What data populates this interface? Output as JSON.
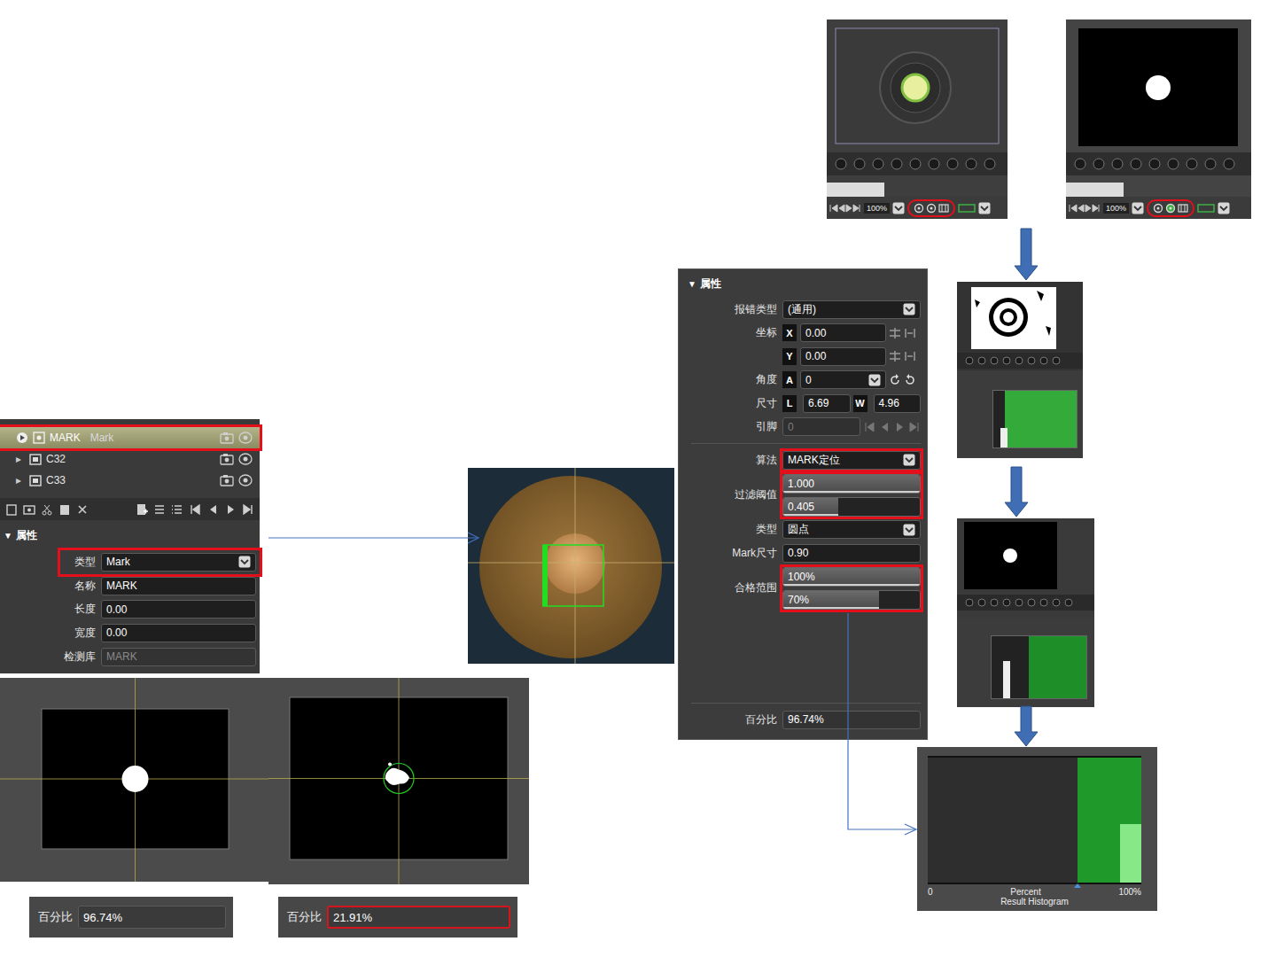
{
  "tree": {
    "rows": [
      {
        "kind": "mark",
        "name": "MARK",
        "type": "Mark",
        "selected": true,
        "annotated": true
      },
      {
        "kind": "group",
        "expander": "▸",
        "name": "C32",
        "selected": false,
        "annotated": false
      },
      {
        "kind": "group",
        "expander": "▸",
        "name": "C33",
        "selected": false,
        "annotated": false
      }
    ]
  },
  "left_props": {
    "arrow": "▼",
    "title": "属性",
    "fields": [
      {
        "kind": "select",
        "label": "类型",
        "value": "Mark",
        "disabled": false,
        "annotated": true
      },
      {
        "kind": "input",
        "label": "名称",
        "value": "MARK",
        "disabled": false,
        "annotated": false
      },
      {
        "kind": "input",
        "label": "长度",
        "value": "0.00",
        "disabled": false,
        "annotated": false
      },
      {
        "kind": "input",
        "label": "宽度",
        "value": "0.00",
        "disabled": false,
        "annotated": false
      },
      {
        "kind": "input",
        "label": "检测库",
        "value": "MARK",
        "disabled": true,
        "annotated": false
      }
    ]
  },
  "props": {
    "arrow": "▼",
    "title": "属性",
    "rows": [
      {
        "kind": "select",
        "label": "报错类型",
        "value": "(通用)",
        "annotated": false
      },
      {
        "kind": "coord",
        "label": "坐标",
        "axis": "X",
        "value": "0.00",
        "annotated": false
      },
      {
        "kind": "coord",
        "axis": "Y",
        "value": "0.00",
        "annotated": false
      },
      {
        "kind": "angle",
        "label": "角度",
        "axis": "A",
        "value": "0",
        "annotated": false
      },
      {
        "kind": "size",
        "label": "尺寸",
        "axis": "L",
        "value": "6.69",
        "axis2": "W",
        "value2": "4.96",
        "annotated": false
      },
      {
        "kind": "pin",
        "label": "引脚",
        "value": "0",
        "disabled": true,
        "annotated": false
      },
      {
        "kind": "select",
        "label": "算法",
        "value": "MARK定位",
        "annotated": true
      },
      {
        "kind": "sliders",
        "label": "过滤阈值",
        "annotated": true,
        "sliders": [
          {
            "value": "1.000",
            "level": 1.0
          },
          {
            "value": "0.405",
            "level": 0.4
          }
        ]
      },
      {
        "kind": "select",
        "label": "类型",
        "value": "圆点",
        "annotated": false
      },
      {
        "kind": "input",
        "label": "Mark尺寸",
        "value": "0.90",
        "annotated": false
      },
      {
        "kind": "sliders",
        "label": "合格范围",
        "annotated": true,
        "sliders": [
          {
            "value": "100%",
            "level": 1.0
          },
          {
            "value": "70%",
            "level": 0.7
          }
        ]
      }
    ],
    "percent": {
      "label": "百分比",
      "value": "96.74%"
    }
  },
  "views": [
    {
      "mode": "raw",
      "zoom": "100%",
      "annotated": true
    },
    {
      "mode": "mask",
      "zoom": "100%",
      "annotated": true
    }
  ],
  "steps": [
    {
      "kind": "binary",
      "threshold_level": 0.14
    },
    {
      "kind": "mask",
      "threshold_level": 0.39
    }
  ],
  "comparisons": [
    {
      "kind": "good",
      "label": "百分比",
      "value": "96.74%",
      "pass": true
    },
    {
      "kind": "bad",
      "label": "百分比",
      "value": "21.91%",
      "pass": false
    }
  ],
  "result_histogram": {
    "title": "Percent",
    "subtitle": "Result Histogram",
    "min_label": "0",
    "max_label": "100%",
    "pass_from": 70,
    "pass_to": 100,
    "bins": [
      {
        "from": 90,
        "to": 100,
        "count": 0.47
      }
    ]
  }
}
